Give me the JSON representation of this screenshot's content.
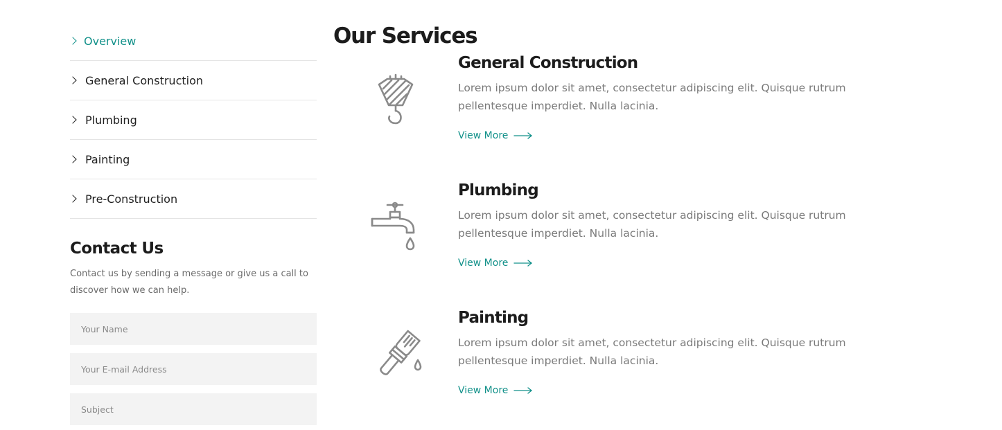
{
  "sidebar": {
    "nav": [
      {
        "label": "Overview",
        "active": true
      },
      {
        "label": "General Construction",
        "active": false
      },
      {
        "label": "Plumbing",
        "active": false
      },
      {
        "label": "Painting",
        "active": false
      },
      {
        "label": "Pre-Construction",
        "active": false
      }
    ],
    "contact": {
      "title": "Contact Us",
      "text": "Contact us by sending a message or give us a call to discover how we can help.",
      "name_placeholder": "Your Name",
      "email_placeholder": "Your E-mail Address",
      "subject_placeholder": "Subject"
    }
  },
  "main": {
    "title": "Our Services",
    "services": [
      {
        "title": "General Construction",
        "description": "Lorem ipsum dolor sit amet, consectetur adipiscing elit. Quisque rutrum pellentesque imperdiet. Nulla lacinia.",
        "link": "View More",
        "icon": "crane-hook-icon"
      },
      {
        "title": "Plumbing",
        "description": "Lorem ipsum dolor sit amet, consectetur adipiscing elit. Quisque rutrum pellentesque imperdiet. Nulla lacinia.",
        "link": "View More",
        "icon": "faucet-icon"
      },
      {
        "title": "Painting",
        "description": "Lorem ipsum dolor sit amet, consectetur adipiscing elit. Quisque rutrum pellentesque imperdiet. Nulla lacinia.",
        "link": "View More",
        "icon": "paint-brush-icon"
      }
    ]
  },
  "colors": {
    "accent": "#12918a",
    "heading": "#1c1c1c",
    "body_text": "#7a7a7a",
    "field_bg": "#f3f3f3",
    "icon": "#8a8a8a"
  }
}
